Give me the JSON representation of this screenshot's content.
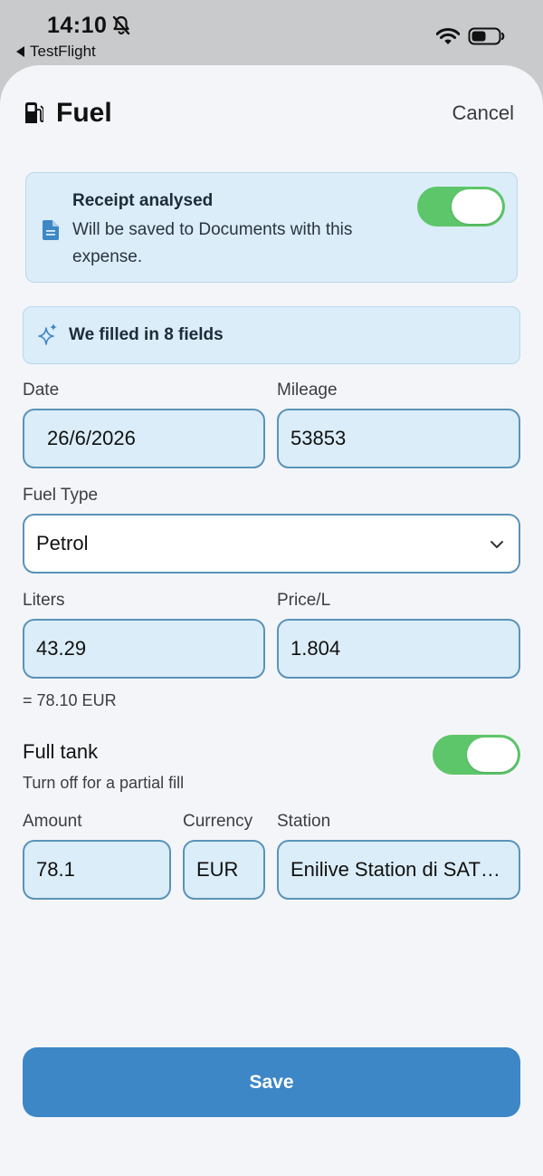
{
  "status_bar": {
    "time": "14:10",
    "back_app": "TestFlight"
  },
  "header": {
    "title": "Fuel",
    "cancel_label": "Cancel"
  },
  "receipt": {
    "title": "Receipt analysed",
    "text": "Will be saved to Documents with this expense.",
    "toggle_on": true
  },
  "autofill": {
    "text": "We filled in 8 fields"
  },
  "form": {
    "date_label": "Date",
    "date_value": "26/6/2026",
    "mileage_label": "Mileage",
    "mileage_value": "53853",
    "fuel_type_label": "Fuel Type",
    "fuel_type_value": "Petrol",
    "liters_label": "Liters",
    "liters_value": "43.29",
    "price_label": "Price/L",
    "price_value": "1.804",
    "total_hint": "= 78.10 EUR",
    "full_tank_label": "Full tank",
    "full_tank_hint": "Turn off for a partial fill",
    "full_tank_on": true,
    "amount_label": "Amount",
    "amount_value": "78.1",
    "currency_label": "Currency",
    "currency_value": "EUR",
    "station_label": "Station",
    "station_value": "Enilive Station di SAT…"
  },
  "save_label": "Save",
  "colors": {
    "accent": "#3d87c6",
    "toggle_on": "#5dc66a",
    "field_bg": "#dbedf8",
    "field_border": "#5a93b8",
    "sheet_bg": "#f4f5f9"
  },
  "icons": [
    "bell-slash-icon",
    "wifi-icon",
    "battery-icon",
    "fuel-pump-icon",
    "document-icon",
    "sparkles-icon",
    "chevron-down-icon"
  ]
}
